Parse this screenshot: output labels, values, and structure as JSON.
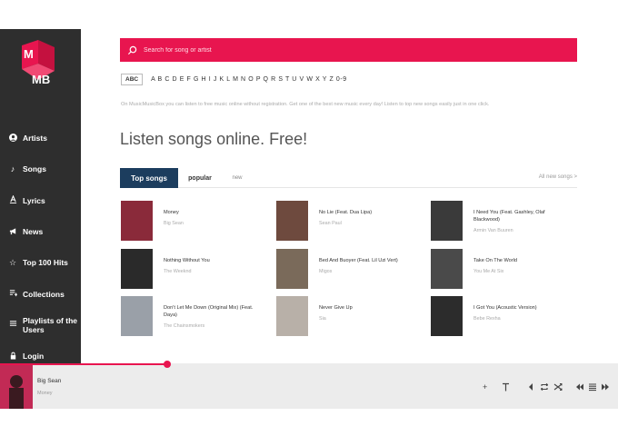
{
  "sidebar": {
    "logo_top": "M",
    "logo_bottom": "MB",
    "items": [
      {
        "label": "Artists",
        "icon": "person-icon"
      },
      {
        "label": "Songs",
        "icon": "music-note-icon"
      },
      {
        "label": "Lyrics",
        "icon": "lyrics-icon"
      },
      {
        "label": "News",
        "icon": "megaphone-icon"
      },
      {
        "label": "Top 100 Hits",
        "icon": "star-icon"
      },
      {
        "label": "Collections",
        "icon": "playlist-icon"
      },
      {
        "label": "Playlists of the Users",
        "icon": "list-icon"
      },
      {
        "label": "Login",
        "icon": "lock-icon"
      }
    ]
  },
  "search": {
    "placeholder": "Search for song or artist"
  },
  "alphabet": {
    "button": "ABC",
    "letters": "A B C D E F G H I J K L M N O P Q R S T U V W X Y Z 0-9"
  },
  "intro": "On MusicMusicBox you can listen to free music online without registration. Get one of the best new music every day! Listen to top new songs easily just in one click.",
  "heading": "Listen songs online. Free!",
  "tabs": {
    "top": "Top songs",
    "popular": "popular",
    "new": "new",
    "all": "All new songs >"
  },
  "songs": [
    {
      "title": "Money",
      "artist": "Big Sean",
      "color": "#8a2a3a"
    },
    {
      "title": "No Lie (Feat. Dua Lipa)",
      "artist": "Sean Paul",
      "color": "#6e4a3e"
    },
    {
      "title": "I Need You (Feat. Gashley, Olaf Blackwood)",
      "artist": "Armin Van Buuren",
      "color": "#3a3a3a"
    },
    {
      "title": "Nothing Without You",
      "artist": "The Weeknd",
      "color": "#2a2a2a"
    },
    {
      "title": "Bed And Buoyer (Feat. Lil Uzi Vert)",
      "artist": "Migos",
      "color": "#7a6a5a"
    },
    {
      "title": "Take On The World",
      "artist": "You Me At Six",
      "color": "#4a4a4a"
    },
    {
      "title": "Don't Let Me Down (Original Mix) (Feat. Daya)",
      "artist": "The Chainsmokers",
      "color": "#9aa0a8"
    },
    {
      "title": "Never Give Up",
      "artist": "Sia",
      "color": "#b8b0a8"
    },
    {
      "title": "I Got You (Acoustic Version)",
      "artist": "Bebe Rexha",
      "color": "#2c2c2c"
    }
  ],
  "player": {
    "artist": "Big Sean",
    "title": "Money",
    "progress": 0.27,
    "thumb_color": "#c22a55"
  },
  "colors": {
    "accent": "#e8154f",
    "sidebar": "#2e2e2e",
    "tab_active": "#1c3d5e"
  }
}
